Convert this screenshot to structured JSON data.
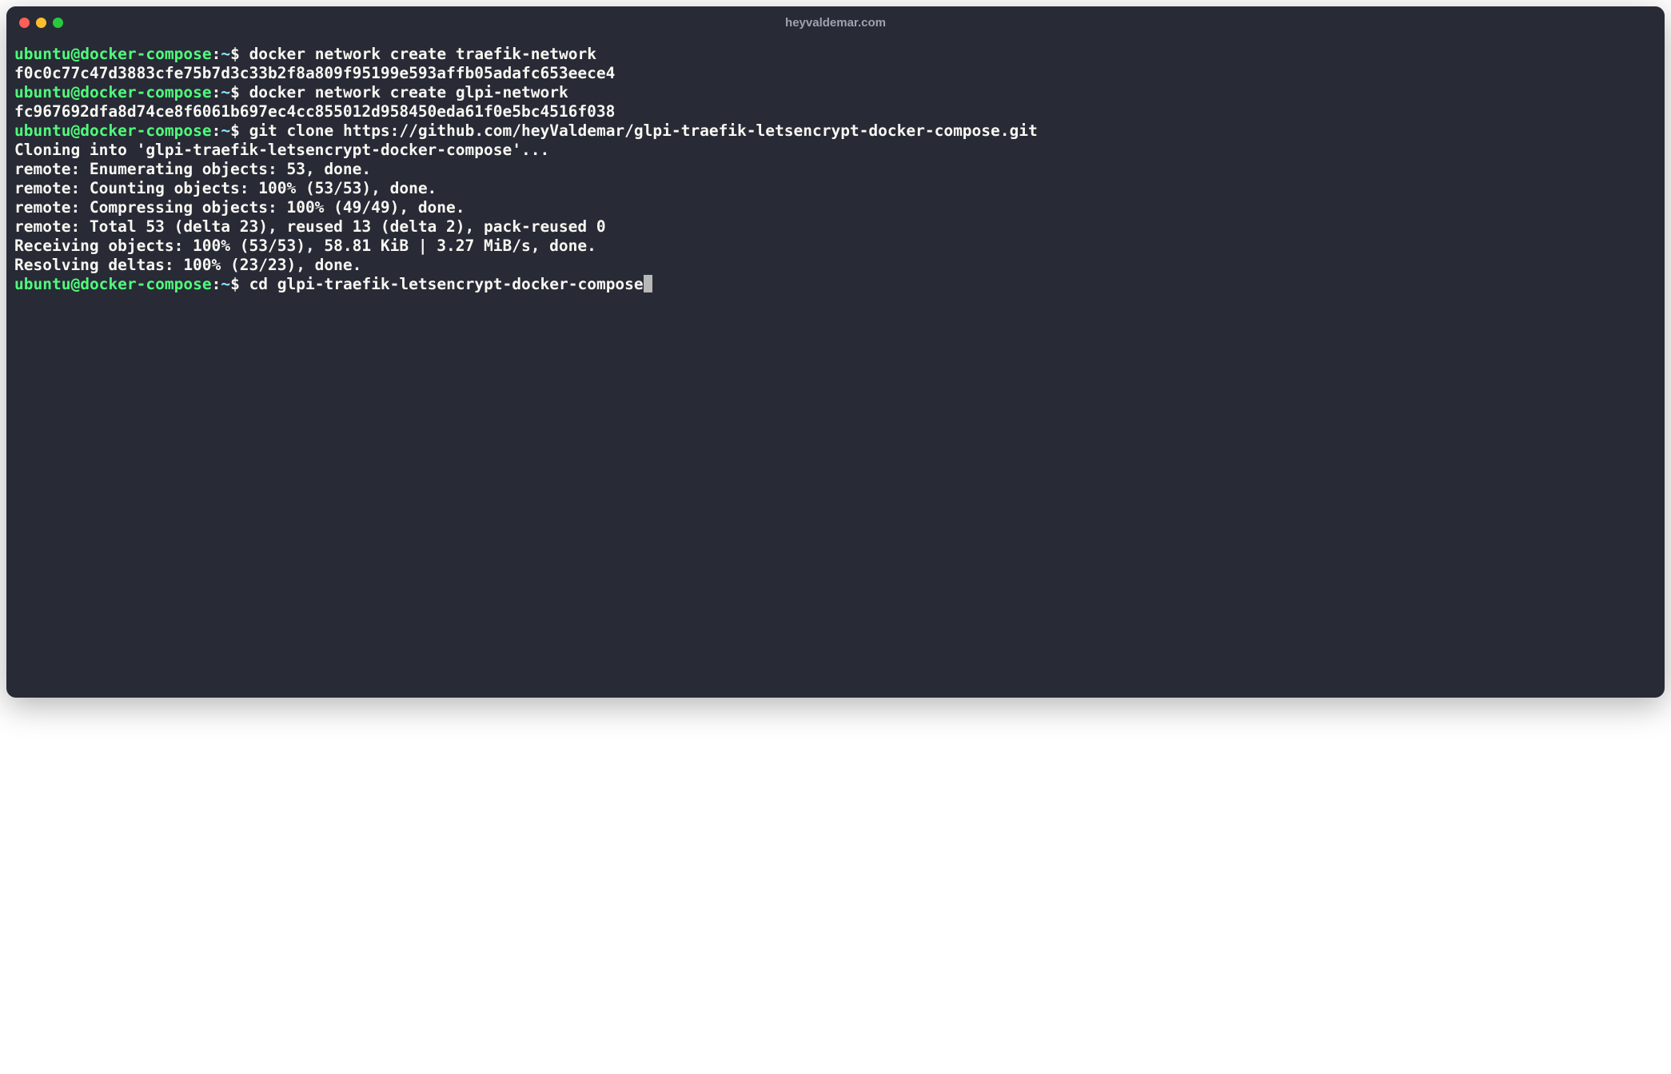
{
  "window": {
    "title": "heyvaldemar.com"
  },
  "prompt": {
    "user": "ubuntu",
    "at": "@",
    "host": "docker-compose",
    "colon": ":",
    "path": "~",
    "dollar": "$"
  },
  "lines": [
    {
      "type": "prompt",
      "command": " docker network create traefik-network"
    },
    {
      "type": "output",
      "text": "f0c0c77c47d3883cfe75b7d3c33b2f8a809f95199e593affb05adafc653eece4"
    },
    {
      "type": "prompt",
      "command": " docker network create glpi-network"
    },
    {
      "type": "output",
      "text": "fc967692dfa8d74ce8f6061b697ec4cc855012d958450eda61f0e5bc4516f038"
    },
    {
      "type": "prompt",
      "command": " git clone https://github.com/heyValdemar/glpi-traefik-letsencrypt-docker-compose.git"
    },
    {
      "type": "output",
      "text": "Cloning into 'glpi-traefik-letsencrypt-docker-compose'..."
    },
    {
      "type": "output",
      "text": "remote: Enumerating objects: 53, done."
    },
    {
      "type": "output",
      "text": "remote: Counting objects: 100% (53/53), done."
    },
    {
      "type": "output",
      "text": "remote: Compressing objects: 100% (49/49), done."
    },
    {
      "type": "output",
      "text": "remote: Total 53 (delta 23), reused 13 (delta 2), pack-reused 0"
    },
    {
      "type": "output",
      "text": "Receiving objects: 100% (53/53), 58.81 KiB | 3.27 MiB/s, done."
    },
    {
      "type": "output",
      "text": "Resolving deltas: 100% (23/23), done."
    },
    {
      "type": "prompt",
      "command": " cd glpi-traefik-letsencrypt-docker-compose",
      "cursor": true
    }
  ]
}
